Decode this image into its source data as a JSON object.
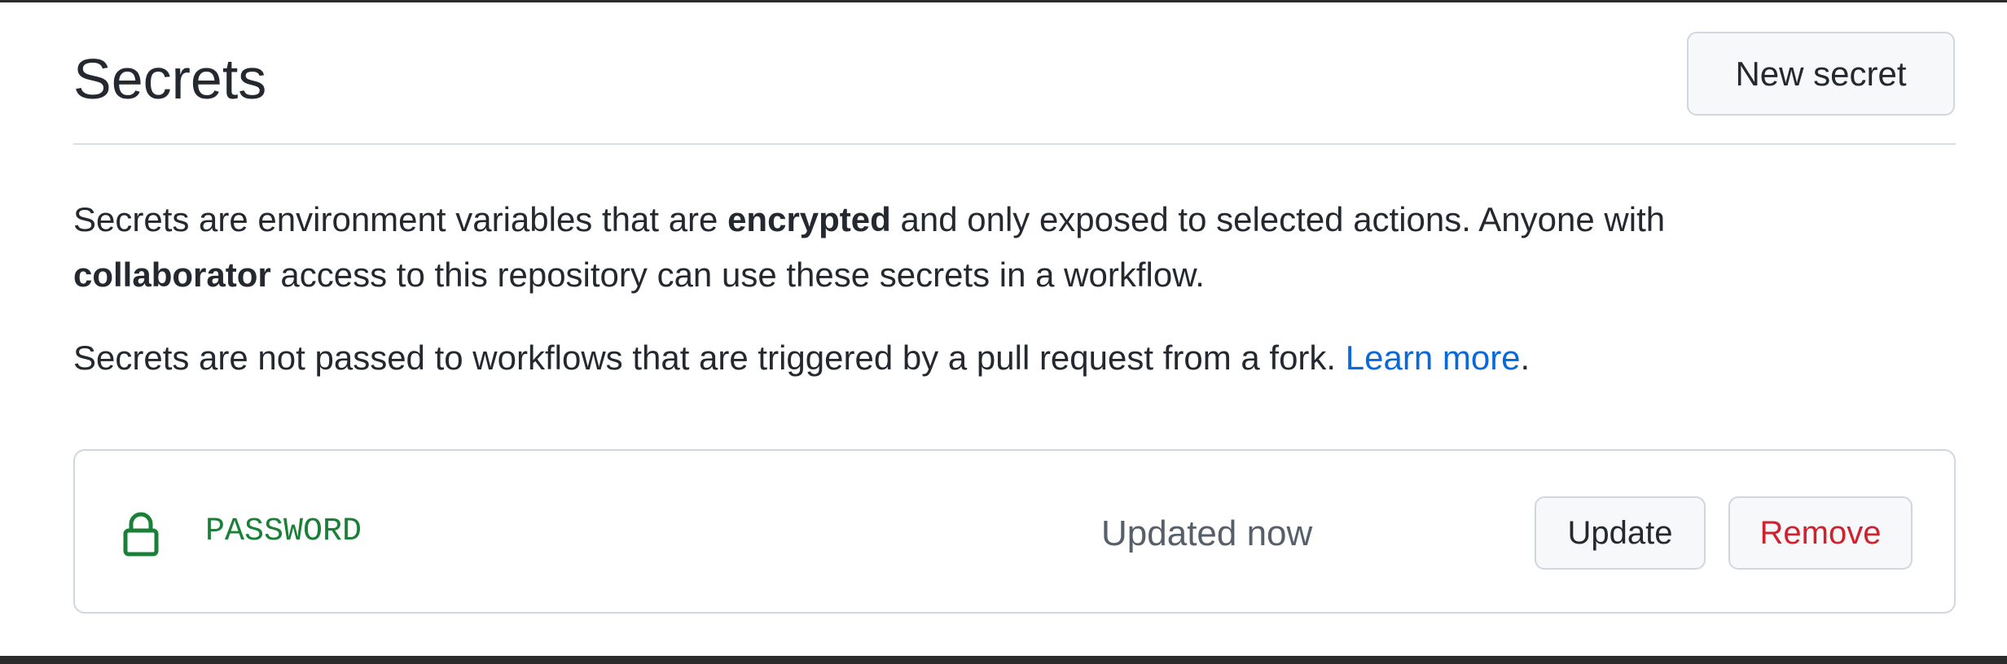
{
  "header": {
    "title": "Secrets",
    "new_secret_label": "New secret"
  },
  "description": {
    "p1_part1": "Secrets are environment variables that are ",
    "p1_bold1": "encrypted",
    "p1_part2": " and only exposed to selected actions. Anyone with",
    "p1_bold2": "collaborator",
    "p1_part3": " access to this repository can use these secrets in a workflow.",
    "p2_text": "Secrets are not passed to workflows that are triggered by a pull request from a fork. ",
    "p2_link": "Learn more",
    "p2_end": "."
  },
  "secrets": [
    {
      "icon": "lock-icon",
      "name": "PASSWORD",
      "status": "Updated now",
      "update_label": "Update",
      "remove_label": "Remove"
    }
  ],
  "colors": {
    "link": "#0969da",
    "secret_name": "#1a7f37",
    "remove": "#cf222e",
    "lock_icon": "#1a7f37"
  }
}
